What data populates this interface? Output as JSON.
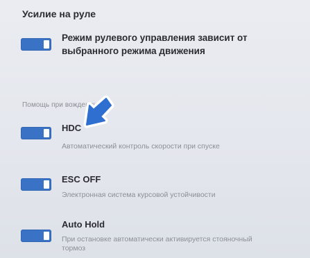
{
  "steering": {
    "title": "Усилие на руле",
    "item": {
      "label": "Режим рулевого управления зависит от выбранного режима движения",
      "enabled": true
    }
  },
  "assist": {
    "section_label": "Помощь при вождении",
    "items": [
      {
        "label": "HDC",
        "description": "Автоматический контроль скорости при спуске",
        "enabled": true
      },
      {
        "label": "ESC OFF",
        "description": "Электронная система курсовой устойчивости",
        "enabled": true
      },
      {
        "label": "Auto Hold",
        "description": "При остановке автоматически активируется стояночный тормоз",
        "enabled": true
      }
    ]
  },
  "annotation": {
    "icon": "pointer-arrow-icon",
    "color": "#2f6fd0"
  },
  "colors": {
    "toggle_on": "#3a73c6",
    "background": "#e6e9ee"
  }
}
